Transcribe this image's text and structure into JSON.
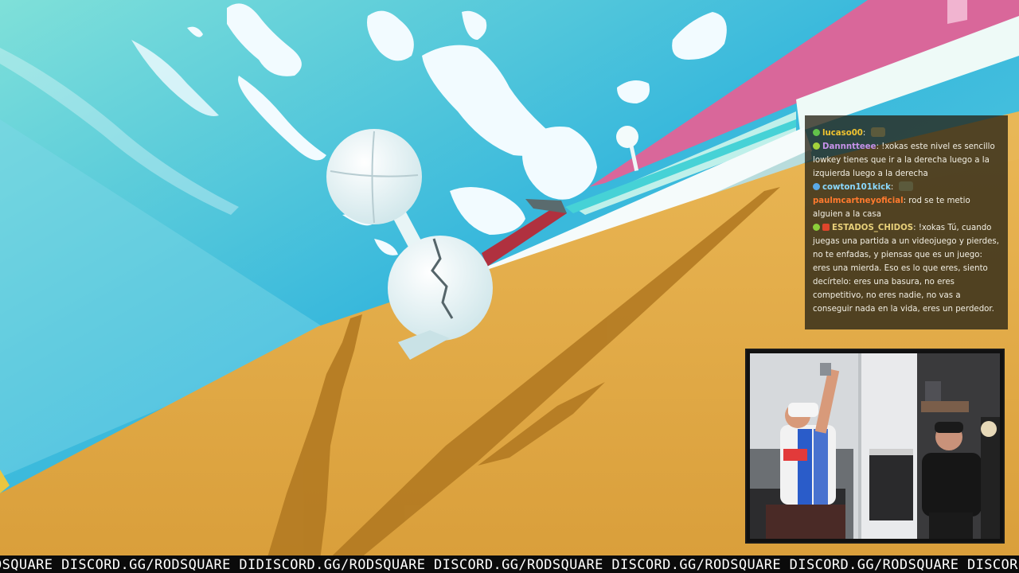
{
  "chat": {
    "messages": [
      {
        "user": "lucaso00",
        "color": "#f0c330",
        "badges": [
          "#62c24a"
        ],
        "text": "",
        "emote": "face-emote"
      },
      {
        "user": "Dannntteee",
        "color": "#c792ea",
        "badges": [
          "#a3d13b"
        ],
        "text": "!xokas este nivel es sencillo lowkey tienes que ir a la derecha luego a la izquierda luego a la derecha",
        "emote": ""
      },
      {
        "user": "cowton101kick",
        "color": "#8ad9ff",
        "badges": [
          "#5aa9e6"
        ],
        "text": "",
        "emote": "face-emote"
      },
      {
        "user": "paulmcartneyoficial",
        "color": "#ff7a2e",
        "badges": [],
        "text": "rod se te metio alguien a la casa",
        "emote": ""
      },
      {
        "user": "ESTADOS_CHIDOS",
        "color": "#e8d07a",
        "badges": [
          "#8ccf3a",
          "#e0452b"
        ],
        "text": "!xokas Tú, cuando juegas una partida a un videojuego y pierdes, no te enfadas, y piensas que es un juego: eres una mierda. Eso es lo que eres, siento decírtelo: eres una basura, no eres competitivo, no eres nadie, no vas a conseguir nada en la vida, eres un perdedor.",
        "emote": ""
      }
    ]
  },
  "ticker": {
    "text": "DSQUARE DISCORD.GG/RODSQUARE DIDISCORD.GG/RODSQUARE DISCORD.GG/RODSQUARE DISCORD.GG/RODSQUARE DISCORD.GG/RODSQUARE DISCORD.GG/RODSQUARE"
  },
  "colors": {
    "sky": "#4ec4dc",
    "ground": "#e3ab45",
    "pink_wall": "#d9679a",
    "chat_bg": "#262216"
  }
}
